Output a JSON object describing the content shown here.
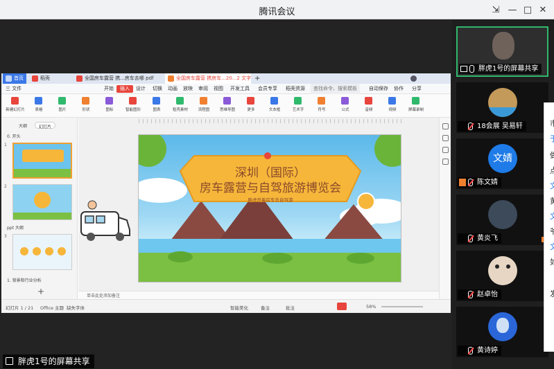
{
  "window": {
    "title": "腾讯会议",
    "min": "—",
    "max": "□",
    "close": "✕",
    "extra": "⇲"
  },
  "wps": {
    "tabs": [
      {
        "label": "首页"
      },
      {
        "label": "稻壳"
      },
      {
        "label": "全国房车露营 携...房车去哪 pdf"
      },
      {
        "label": "全国房车露营 携房车...20...2 文字稿"
      }
    ],
    "new_tab": "+",
    "menu": [
      "三 文件",
      "开始",
      "插入",
      "设计",
      "切换",
      "动画",
      "放映",
      "审阅",
      "视图",
      "开发工具",
      "会员专享",
      "稻壳资源"
    ],
    "search": "查找命令、搜索模板",
    "menu_right": [
      "自动保存",
      "协作",
      "分享"
    ],
    "ribbon": [
      "新建幻灯片",
      "表格",
      "图片",
      "形状",
      "图标",
      "智能图形",
      "图表",
      "稻壳素材",
      "流程图",
      "思维导图",
      "更多",
      "文本框",
      "艺术字",
      "符号",
      "公式",
      "音频",
      "视频",
      "屏幕录制"
    ],
    "panel_tabs": [
      "大纲",
      "幻灯片"
    ],
    "sections": [
      "0. 开头",
      "ppt 大纲",
      "1. 背景和行业分析"
    ],
    "slide_numbers": [
      "1",
      "2",
      "3"
    ],
    "slide": {
      "title_line1": "深圳（国际）",
      "title_line2": "房车露营与自驾旅游博览会",
      "subtitle": "胖虎开着房车去自驾游"
    },
    "notes": "单击此处添加备注",
    "status": {
      "page": "幻灯片 1 / 21",
      "theme": "Office 主题",
      "font": "缺失字体",
      "notes_btn": "智能美化",
      "comment": "备注",
      "annot": "批注",
      "zoom": "58%"
    }
  },
  "share_label": "胖虎1号的屏幕共享",
  "participants": [
    {
      "name": "胖虎1号的屏幕共享",
      "initial": "",
      "active": true
    },
    {
      "name": "18会展 吴易轩",
      "initial": ""
    },
    {
      "name": "陈文婧",
      "initial": "文婧"
    },
    {
      "name": "黄炎飞",
      "initial": ""
    },
    {
      "name": "赵卓怡",
      "initial": ""
    },
    {
      "name": "黄诗婷",
      "initial": ""
    }
  ],
  "chat_fragments": [
    "市",
    "于",
    "做",
    "点",
    "文",
    "黄",
    "文",
    "爷",
    "文",
    "如",
    "发"
  ],
  "colors": {
    "wps_red": "#e8453c",
    "active_border": "#2fb96c",
    "sky": "#5bb9ea",
    "banner": "#f6b63a"
  }
}
